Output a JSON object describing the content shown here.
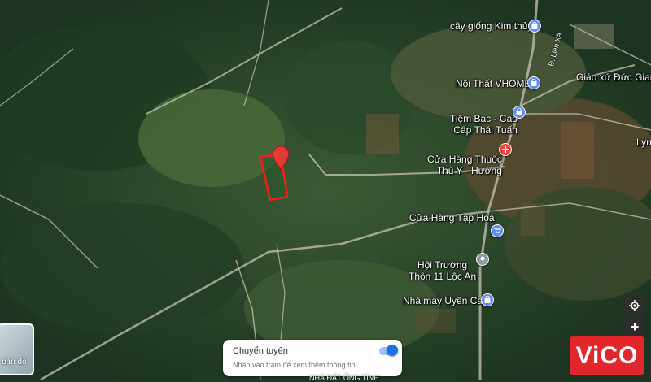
{
  "map": {
    "type": "satellite",
    "places": [
      {
        "name": "cây giống Kim thủy",
        "category": "shopping",
        "color": "#5e8cf0"
      },
      {
        "name": "Nội Thất VHOME",
        "category": "shopping",
        "color": "#5e8cf0"
      },
      {
        "name": "Tiệm Bạc - Cao\nCấp Thái Tuấn",
        "category": "shopping",
        "color": "#5e8cf0"
      },
      {
        "name": "Cửa Hàng Thuốc\nThú Y - Hường",
        "category": "pharmacy",
        "color": "#e8453c"
      },
      {
        "name": "Cửa Hàng Tạp Hóa",
        "category": "grocery",
        "color": "#5e8cf0"
      },
      {
        "name": "Hội Trường\nThôn 11 Lộc An",
        "category": "place",
        "color": "#8a9aa8"
      },
      {
        "name": "Nhà may Uyên Cat",
        "category": "shopping",
        "color": "#5e8cf0"
      },
      {
        "name": "Giáo xứ Đức Giang",
        "category": "place",
        "color": "#8a9aa8"
      },
      {
        "name": "Lyn",
        "category": "place",
        "color": "#8a9aa8"
      }
    ],
    "road_label": "Đ. Liên Xã",
    "selected_marker": {
      "color": "#e53935"
    },
    "highlight_parcel": {
      "color": "#ff1a1a"
    }
  },
  "controls": {
    "locate_icon": "my-location-icon",
    "zoom_in_label": "+",
    "minimap_label": "bản đồ"
  },
  "transit_card": {
    "title": "Chuyển tuyến",
    "hint": "Nhấp vào trạm để xem thêm thông tin",
    "toggle_on": true
  },
  "brand": {
    "logo_text": "ViCO",
    "color": "#e2262b"
  },
  "footer": {
    "text": "NHÀ ĐẤT ỐNG TÍNH"
  }
}
